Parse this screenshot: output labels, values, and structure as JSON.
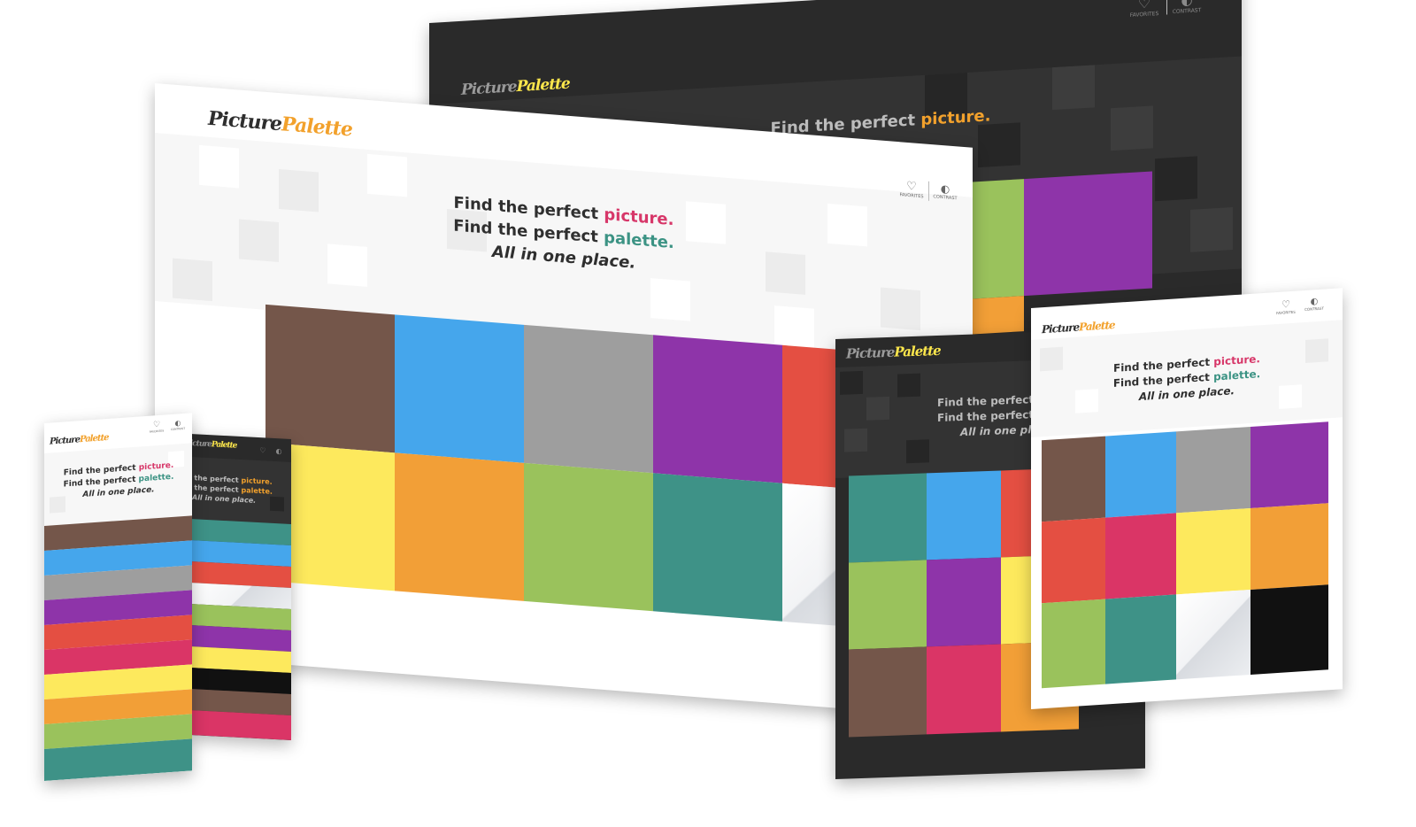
{
  "brand": {
    "part1": "Picture",
    "part2": "Palette"
  },
  "headline": {
    "prefix": "Find the perfect",
    "word1": "picture.",
    "word2": "palette.",
    "tagline": "All in one place."
  },
  "header": {
    "favorites_label": "FAVORITES",
    "contrast_label": "CONTRAST"
  },
  "colors": {
    "logo_accent_light": "#f2a12c",
    "logo_accent_dark": "#fde74c",
    "picture_accent": "#d73769",
    "palette_accent": "#3c9384",
    "dark_theme_accent": "#f2a12c"
  },
  "palette": [
    {
      "name": "brown",
      "hex": "#74564a"
    },
    {
      "name": "blue",
      "hex": "#45a6ec"
    },
    {
      "name": "grey",
      "hex": "#9e9e9e"
    },
    {
      "name": "purple",
      "hex": "#8e34a9"
    },
    {
      "name": "red",
      "hex": "#e44f42"
    },
    {
      "name": "pink",
      "hex": "#da3566"
    },
    {
      "name": "yellow",
      "hex": "#fde95d"
    },
    {
      "name": "orange",
      "hex": "#f29f37"
    },
    {
      "name": "green",
      "hex": "#9ac25c"
    },
    {
      "name": "teal",
      "hex": "#3e9287"
    },
    {
      "name": "white",
      "hex": "#f4f5f7"
    },
    {
      "name": "black",
      "hex": "#111111"
    }
  ]
}
